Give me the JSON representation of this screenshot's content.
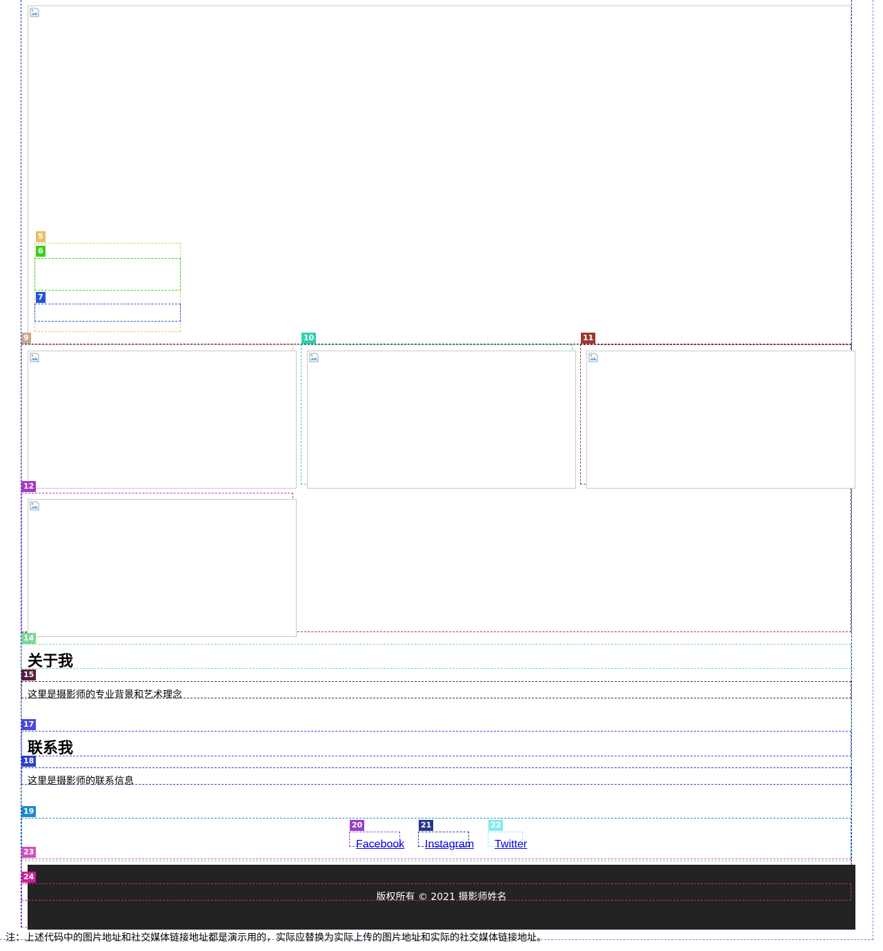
{
  "images": {
    "hero_alt": "",
    "gallery": [
      "",
      "",
      "",
      ""
    ]
  },
  "about": {
    "title": "关于我",
    "text": "这里是摄影师的专业背景和艺术理念"
  },
  "contact": {
    "title": "联系我",
    "text": "这里是摄影师的联系信息"
  },
  "social": {
    "links": [
      "Facebook",
      "Instagram",
      "Twitter"
    ]
  },
  "footer": {
    "copyright": "版权所有 © 2021 摄影师姓名"
  },
  "note": "注：上述代码中的图片地址和社交媒体链接地址都是演示用的，实际应替换为实际上传的图片地址和实际的社交媒体链接地址。",
  "debug_tags": [
    "5",
    "6",
    "7",
    "9",
    "10",
    "11",
    "12",
    "14",
    "15",
    "17",
    "18",
    "19",
    "20",
    "21",
    "22",
    "23",
    "24"
  ],
  "colors": {
    "footer_bg": "#232323",
    "link": "#0000ee",
    "tag5": "#e8c060",
    "tag6": "#3cd01e",
    "tag7": "#2356d8",
    "tag9": "#c8a890",
    "tag10": "#2fcfb0",
    "tag11": "#9c3a2e",
    "tag12": "#a63ac8",
    "tag14": "#7ed69a",
    "tag15": "#5a2040",
    "tag17": "#4a4ad8",
    "tag18": "#2f3fc8",
    "tag19": "#1e8ad0",
    "tag20": "#9840c8",
    "tag21": "#283890",
    "tag22": "#88eaf0",
    "tag23": "#d050c0",
    "tag24": "#d0209a"
  }
}
